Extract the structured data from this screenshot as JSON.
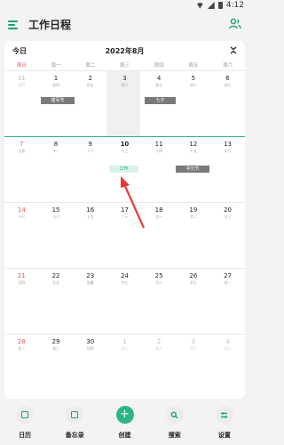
{
  "status": {
    "time": "4:12"
  },
  "app": {
    "title": "工作日程"
  },
  "calendar": {
    "today_label": "今日",
    "month_title": "2022年8月",
    "weekdays": [
      "周日",
      "周一",
      "周二",
      "周三",
      "周四",
      "周五",
      "周六"
    ],
    "weeks": [
      [
        {
          "n": "31",
          "l": "初四",
          "other": true
        },
        {
          "n": "1",
          "l": "初四"
        },
        {
          "n": "2",
          "l": "初五"
        },
        {
          "n": "3",
          "l": "初六"
        },
        {
          "n": "4",
          "l": "初七"
        },
        {
          "n": "5",
          "l": "初八"
        },
        {
          "n": "6",
          "l": "初九"
        }
      ],
      [
        {
          "n": "7",
          "l": "立秋"
        },
        {
          "n": "8",
          "l": "十一"
        },
        {
          "n": "9",
          "l": "十二"
        },
        {
          "n": "10",
          "l": "十三",
          "today": true
        },
        {
          "n": "11",
          "l": "十四"
        },
        {
          "n": "12",
          "l": "十五"
        },
        {
          "n": "13",
          "l": "十六"
        }
      ],
      [
        {
          "n": "14",
          "l": "十七"
        },
        {
          "n": "15",
          "l": "十八"
        },
        {
          "n": "16",
          "l": "十九"
        },
        {
          "n": "17",
          "l": "二十"
        },
        {
          "n": "18",
          "l": "廿一"
        },
        {
          "n": "19",
          "l": "廿二"
        },
        {
          "n": "20",
          "l": "廿三"
        }
      ],
      [
        {
          "n": "21",
          "l": "廿四"
        },
        {
          "n": "22",
          "l": "廿五"
        },
        {
          "n": "23",
          "l": "处暑"
        },
        {
          "n": "24",
          "l": "廿七"
        },
        {
          "n": "25",
          "l": "廿八"
        },
        {
          "n": "26",
          "l": "廿九"
        },
        {
          "n": "27",
          "l": "初一"
        }
      ],
      [
        {
          "n": "28",
          "l": "初二"
        },
        {
          "n": "29",
          "l": "初三"
        },
        {
          "n": "30",
          "l": "初四"
        },
        {
          "n": "1",
          "l": "初六",
          "other": true
        },
        {
          "n": "2",
          "l": "初七",
          "other": true
        },
        {
          "n": "3",
          "l": "初八",
          "other": true
        },
        {
          "n": "4",
          "l": "初九",
          "other": true
        }
      ]
    ],
    "events": {
      "army_day": "建军节",
      "qixi": "七夕",
      "work": "工作",
      "ghost_festival": "中元节"
    }
  },
  "nav": [
    {
      "label": "日历"
    },
    {
      "label": "备忘录"
    },
    {
      "label": "创建",
      "icon": "+"
    },
    {
      "label": "搜索"
    },
    {
      "label": "设置"
    }
  ],
  "colors": {
    "accent": "#2bb58a",
    "sunday": "#e05a5a",
    "event_gray": "#7a7a7a",
    "arrow": "#e53935"
  }
}
